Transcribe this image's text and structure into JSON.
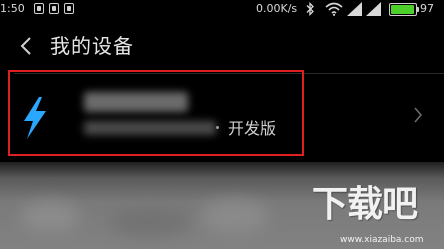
{
  "status_bar": {
    "time": "1:50",
    "net_speed": "0.00K/s",
    "battery_percent": "97",
    "battery_level": 0.97,
    "battery_color": "#4ccf2a",
    "icons": [
      "notification-icon",
      "notification-icon",
      "notification-icon",
      "bluetooth-icon",
      "wifi-icon",
      "signal-icon",
      "battery-icon"
    ]
  },
  "header": {
    "back_icon": "chevron-left-icon",
    "title": "我的设备"
  },
  "device": {
    "icon": "lightning-bolt-icon",
    "icon_color": "#2aa8ff",
    "tag": "开发版",
    "chevron_icon": "chevron-right-icon",
    "highlight_color": "#e02020"
  },
  "watermark": {
    "text": "下载吧",
    "url": "www.xiazaiba.com"
  }
}
